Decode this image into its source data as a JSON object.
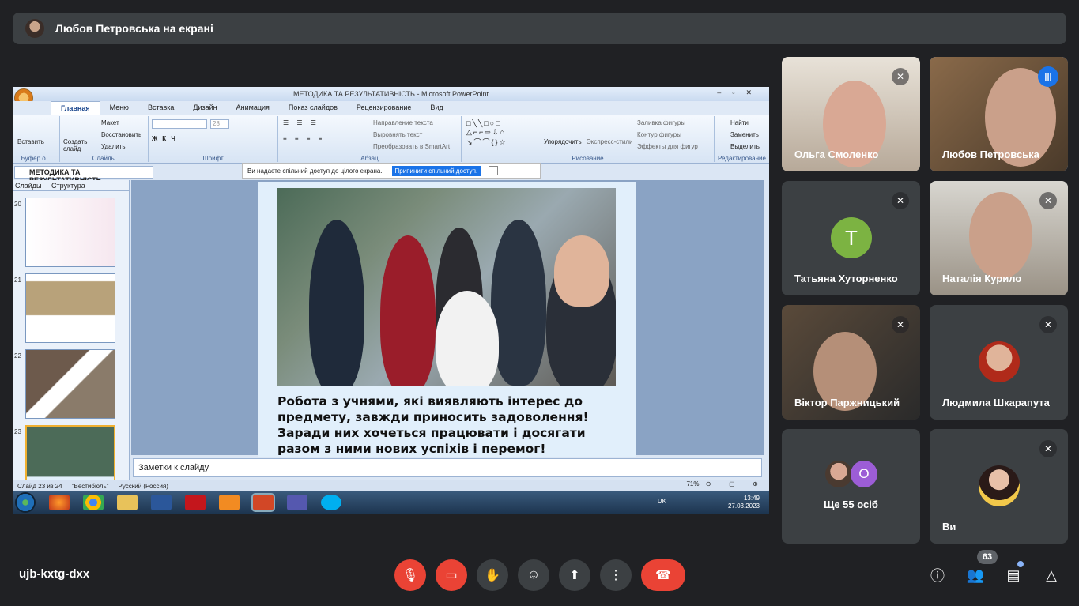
{
  "banner": {
    "text": "Любов Петровська на екрані"
  },
  "powerpoint": {
    "window_title": "МЕТОДИКА ТА РЕЗУЛЬТАТИВНІСТЬ - Microsoft PowerPoint",
    "tabs": [
      "Главная",
      "Меню",
      "Вставка",
      "Дизайн",
      "Анимация",
      "Показ слайдов",
      "Рецензирование",
      "Вид"
    ],
    "ribbon": {
      "paste": "Вставить",
      "clipboard": "Буфер о...",
      "create_slide": "Создать слайд",
      "layout": "Макет",
      "restore": "Восстановить",
      "delete": "Удалить",
      "slides_group": "Слайды",
      "font_size": "28",
      "font_group": "Шрифт",
      "text_direction": "Направление текста",
      "align_text": "Выровнять текст",
      "smartart": "Преобразовать в SmartArt",
      "paragraph_group": "Абзац",
      "arrange": "Упорядочить",
      "quick_styles": "Экспресс-стили",
      "shape_fill": "Заливка фигуры",
      "shape_outline": "Контур фигуры",
      "shape_effects": "Эффекты для фигур",
      "drawing_group": "Рисование",
      "find": "Найти",
      "replace": "Заменить",
      "select": "Выделить",
      "editing_group": "Редактирование"
    },
    "share_bar": {
      "text": "Ви надаєте спільний доступ до цілого екрана.",
      "stop": "Припинити спільний доступ."
    },
    "doc_tab": "МЕТОДИКА ТА РЕЗУЛЬТАТИВНІСТЬ",
    "pane_tabs": {
      "slides": "Слайды",
      "outline": "Структура"
    },
    "thumb_numbers": [
      "20",
      "21",
      "22",
      "23"
    ],
    "slide_caption": "Робота з учнями, які виявляють інтерес до предмету, завжди приносить задоволення! Заради них хочеться працювати і досягати разом з ними нових успіхів і перемог!",
    "notes_placeholder": "Заметки к слайду",
    "status": {
      "slide": "Слайд 23 из 24",
      "theme": "\"Вестибюль\"",
      "language": "Русский (Россия)",
      "zoom": "71%"
    },
    "tray": {
      "lang": "UK",
      "time": "13:49",
      "date": "27.03.2023"
    }
  },
  "participants": [
    {
      "name": "Ольга Смоленко",
      "muted": true
    },
    {
      "name": "Любов Петровська",
      "speaking": true
    },
    {
      "name": "Татьяна Хуторненко",
      "muted": true,
      "initial": "Т"
    },
    {
      "name": "Наталія Курило",
      "muted": true
    },
    {
      "name": "Віктор Паржницький",
      "muted": true
    },
    {
      "name": "Людмила Шкарапута",
      "muted": true
    },
    {
      "name": "Ще 55 осіб",
      "initial": "О"
    },
    {
      "name": "Ви",
      "muted": true
    }
  ],
  "bottom": {
    "meeting_code": "ujb-kxtg-dxx",
    "participant_count": "63"
  },
  "colors": {
    "background": "#202124",
    "tile": "#3c4043",
    "danger": "#ea4335",
    "accent": "#1a73e8"
  }
}
